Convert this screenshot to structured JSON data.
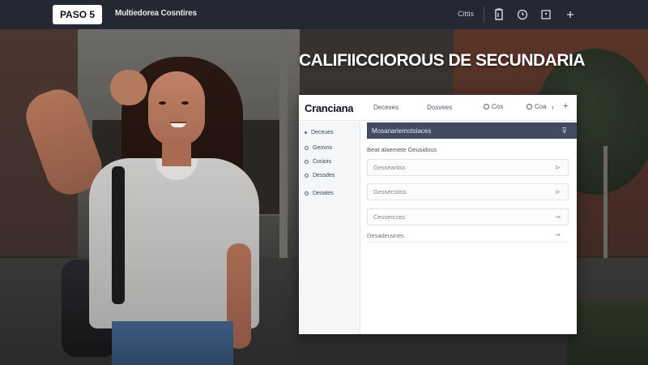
{
  "topbar": {
    "step_badge": "PASO 5",
    "title": "Multiedorea Cosntires",
    "label": "Cittis",
    "icons": [
      "document-icon",
      "clock-icon",
      "square-icon",
      "plus-icon"
    ]
  },
  "headline": "CALIFIICCIOROUS DE SECUNDARIA",
  "panel": {
    "brand": "Cranciana",
    "tabs": [
      "Deceves",
      "Dosvees"
    ],
    "controls": [
      "Cos",
      "Coa"
    ],
    "sidebar": {
      "items": [
        {
          "label": "Deceues",
          "icon": "bullet-icon"
        },
        {
          "label": "Geovns",
          "icon": "circle-icon"
        },
        {
          "label": "Cosiois",
          "icon": "circle-icon"
        },
        {
          "label": "Dessdes",
          "icon": "circle-icon"
        },
        {
          "label": "Deoales",
          "icon": "circle-icon"
        }
      ]
    },
    "main": {
      "section_title": "Mosanariemotsiaces",
      "section_icon": "filter-icon",
      "sub_label": "Beat alaemete Geusidous",
      "fields": [
        {
          "placeholder": "Gesseartiss",
          "icon": "chevron-right-icon"
        },
        {
          "placeholder": "Gessecstiss",
          "icon": "chevron-right-icon"
        },
        {
          "placeholder": "Cessercces",
          "icon": "arrow-icon"
        }
      ],
      "plain_row": {
        "label": "Desadeuvnes",
        "icon": "arrow-icon"
      }
    }
  },
  "colors": {
    "topbar_bg": "#232833",
    "section_bar_bg": "#414b62",
    "panel_bg": "#ffffff"
  }
}
